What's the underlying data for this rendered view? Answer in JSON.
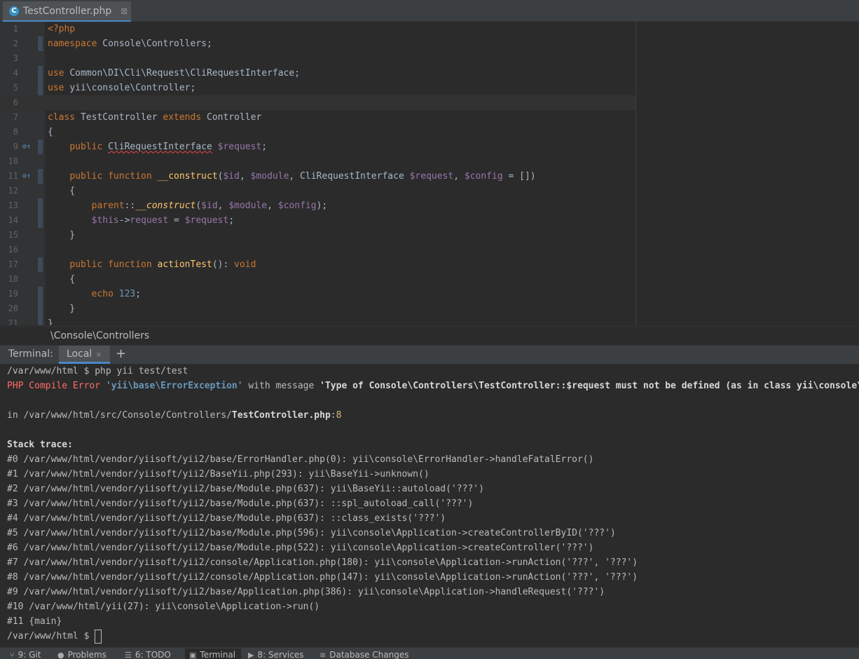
{
  "editor": {
    "tab_label": "TestController.php",
    "tab_icon": "C",
    "breadcrumb": "\\Console\\Controllers",
    "lines": [
      {
        "n": "1",
        "segs": [
          {
            "c": "kw",
            "t": "<?php"
          }
        ]
      },
      {
        "n": "2",
        "segs": [
          {
            "c": "kw",
            "t": "namespace "
          },
          {
            "c": "",
            "t": "Console\\Controllers;"
          }
        ]
      },
      {
        "n": "3",
        "segs": []
      },
      {
        "n": "4",
        "segs": [
          {
            "c": "kw",
            "t": "use "
          },
          {
            "c": "",
            "t": "Common\\DI\\Cli\\Request\\CliRequestInterface;"
          }
        ]
      },
      {
        "n": "5",
        "segs": [
          {
            "c": "kw",
            "t": "use "
          },
          {
            "c": "",
            "t": "yii\\console\\Controller;"
          }
        ]
      },
      {
        "n": "6",
        "segs": []
      },
      {
        "n": "7",
        "segs": [
          {
            "c": "kw",
            "t": "class "
          },
          {
            "c": "",
            "t": "TestController "
          },
          {
            "c": "kw",
            "t": "extends "
          },
          {
            "c": "",
            "t": "Controller"
          }
        ]
      },
      {
        "n": "8",
        "segs": [
          {
            "c": "",
            "t": "{"
          }
        ]
      },
      {
        "n": "9",
        "segs": [
          {
            "c": "",
            "t": "    "
          },
          {
            "c": "kw",
            "t": "public "
          },
          {
            "c": "warn",
            "t": "CliRequestInterface"
          },
          {
            "c": "",
            "t": " "
          },
          {
            "c": "var",
            "t": "$request"
          },
          {
            "c": "",
            "t": ";"
          }
        ]
      },
      {
        "n": "10",
        "segs": []
      },
      {
        "n": "11",
        "segs": [
          {
            "c": "",
            "t": "    "
          },
          {
            "c": "kw",
            "t": "public function "
          },
          {
            "c": "fnd",
            "t": "__construct"
          },
          {
            "c": "",
            "t": "("
          },
          {
            "c": "var",
            "t": "$id"
          },
          {
            "c": "",
            "t": ", "
          },
          {
            "c": "var",
            "t": "$module"
          },
          {
            "c": "",
            "t": ", CliRequestInterface "
          },
          {
            "c": "var",
            "t": "$request"
          },
          {
            "c": "",
            "t": ", "
          },
          {
            "c": "var",
            "t": "$config"
          },
          {
            "c": "",
            "t": " = [])"
          }
        ]
      },
      {
        "n": "12",
        "segs": [
          {
            "c": "",
            "t": "    {"
          }
        ]
      },
      {
        "n": "13",
        "segs": [
          {
            "c": "",
            "t": "        "
          },
          {
            "c": "kw",
            "t": "parent"
          },
          {
            "c": "",
            "t": "::"
          },
          {
            "c": "fn",
            "t": "__construct"
          },
          {
            "c": "",
            "t": "("
          },
          {
            "c": "var",
            "t": "$id"
          },
          {
            "c": "",
            "t": ", "
          },
          {
            "c": "var",
            "t": "$module"
          },
          {
            "c": "",
            "t": ", "
          },
          {
            "c": "var",
            "t": "$config"
          },
          {
            "c": "",
            "t": ");"
          }
        ]
      },
      {
        "n": "14",
        "segs": [
          {
            "c": "",
            "t": "        "
          },
          {
            "c": "var",
            "t": "$this"
          },
          {
            "c": "",
            "t": "->"
          },
          {
            "c": "var",
            "t": "request"
          },
          {
            "c": "",
            "t": " = "
          },
          {
            "c": "var",
            "t": "$request"
          },
          {
            "c": "",
            "t": ";"
          }
        ]
      },
      {
        "n": "15",
        "segs": [
          {
            "c": "",
            "t": "    }"
          }
        ]
      },
      {
        "n": "16",
        "segs": []
      },
      {
        "n": "17",
        "segs": [
          {
            "c": "",
            "t": "    "
          },
          {
            "c": "kw",
            "t": "public function "
          },
          {
            "c": "fnd",
            "t": "actionTest"
          },
          {
            "c": "",
            "t": "(): "
          },
          {
            "c": "kw",
            "t": "void"
          }
        ]
      },
      {
        "n": "18",
        "segs": [
          {
            "c": "",
            "t": "    {"
          }
        ]
      },
      {
        "n": "19",
        "segs": [
          {
            "c": "",
            "t": "        "
          },
          {
            "c": "kw",
            "t": "echo "
          },
          {
            "c": "num2",
            "t": "123"
          },
          {
            "c": "",
            "t": ";"
          }
        ]
      },
      {
        "n": "20",
        "segs": [
          {
            "c": "",
            "t": "    }"
          }
        ]
      },
      {
        "n": "21",
        "segs": [
          {
            "c": "",
            "t": "}"
          }
        ]
      }
    ]
  },
  "terminal": {
    "title": "Terminal:",
    "tab_label": "Local",
    "close_glyph": "×",
    "plus_glyph": "+",
    "prompt_command": "/var/www/html $ php yii test/test",
    "error_prefix": "PHP Compile Error ",
    "error_class": "'yii\\base\\ErrorException'",
    "error_with": " with message ",
    "error_message": "'Type of Console\\Controllers\\TestController::$request must not be defined (as in class yii\\console\\Controller)'",
    "in_prefix": "in /var/www/html/src/Console/Controllers/",
    "in_file": "TestController.php",
    "in_colon": ":",
    "in_line": "8",
    "stack_title": "Stack trace:",
    "stack": [
      "#0 /var/www/html/vendor/yiisoft/yii2/base/ErrorHandler.php(0): yii\\console\\ErrorHandler->handleFatalError()",
      "#1 /var/www/html/vendor/yiisoft/yii2/BaseYii.php(293): yii\\BaseYii->unknown()",
      "#2 /var/www/html/vendor/yiisoft/yii2/base/Module.php(637): yii\\BaseYii::autoload('???')",
      "#3 /var/www/html/vendor/yiisoft/yii2/base/Module.php(637): ::spl_autoload_call('???')",
      "#4 /var/www/html/vendor/yiisoft/yii2/base/Module.php(637): ::class_exists('???')",
      "#5 /var/www/html/vendor/yiisoft/yii2/base/Module.php(596): yii\\console\\Application->createControllerByID('???')",
      "#6 /var/www/html/vendor/yiisoft/yii2/base/Module.php(522): yii\\console\\Application->createController('???')",
      "#7 /var/www/html/vendor/yiisoft/yii2/console/Application.php(180): yii\\console\\Application->runAction('???', '???')",
      "#8 /var/www/html/vendor/yiisoft/yii2/console/Application.php(147): yii\\console\\Application->runAction('???', '???')",
      "#9 /var/www/html/vendor/yiisoft/yii2/base/Application.php(386): yii\\console\\Application->handleRequest('???')",
      "#10 /var/www/html/yii(27): yii\\console\\Application->run()",
      "#11 {main}"
    ],
    "final_prompt": "/var/www/html $ "
  },
  "statusbar": [
    {
      "label": "9: Git",
      "icon": "git-branch-icon",
      "glyph": "⑂"
    },
    {
      "label": "Problems",
      "icon": "problems-icon",
      "glyph": "●"
    },
    {
      "label": "6: TODO",
      "icon": "todo-list-icon",
      "glyph": "☰"
    },
    {
      "label": "Terminal",
      "icon": "terminal-icon",
      "glyph": "▣",
      "active": true
    },
    {
      "label": "8: Services",
      "icon": "services-icon",
      "glyph": "▶"
    },
    {
      "label": "Database Changes",
      "icon": "database-icon",
      "glyph": "≋"
    }
  ]
}
